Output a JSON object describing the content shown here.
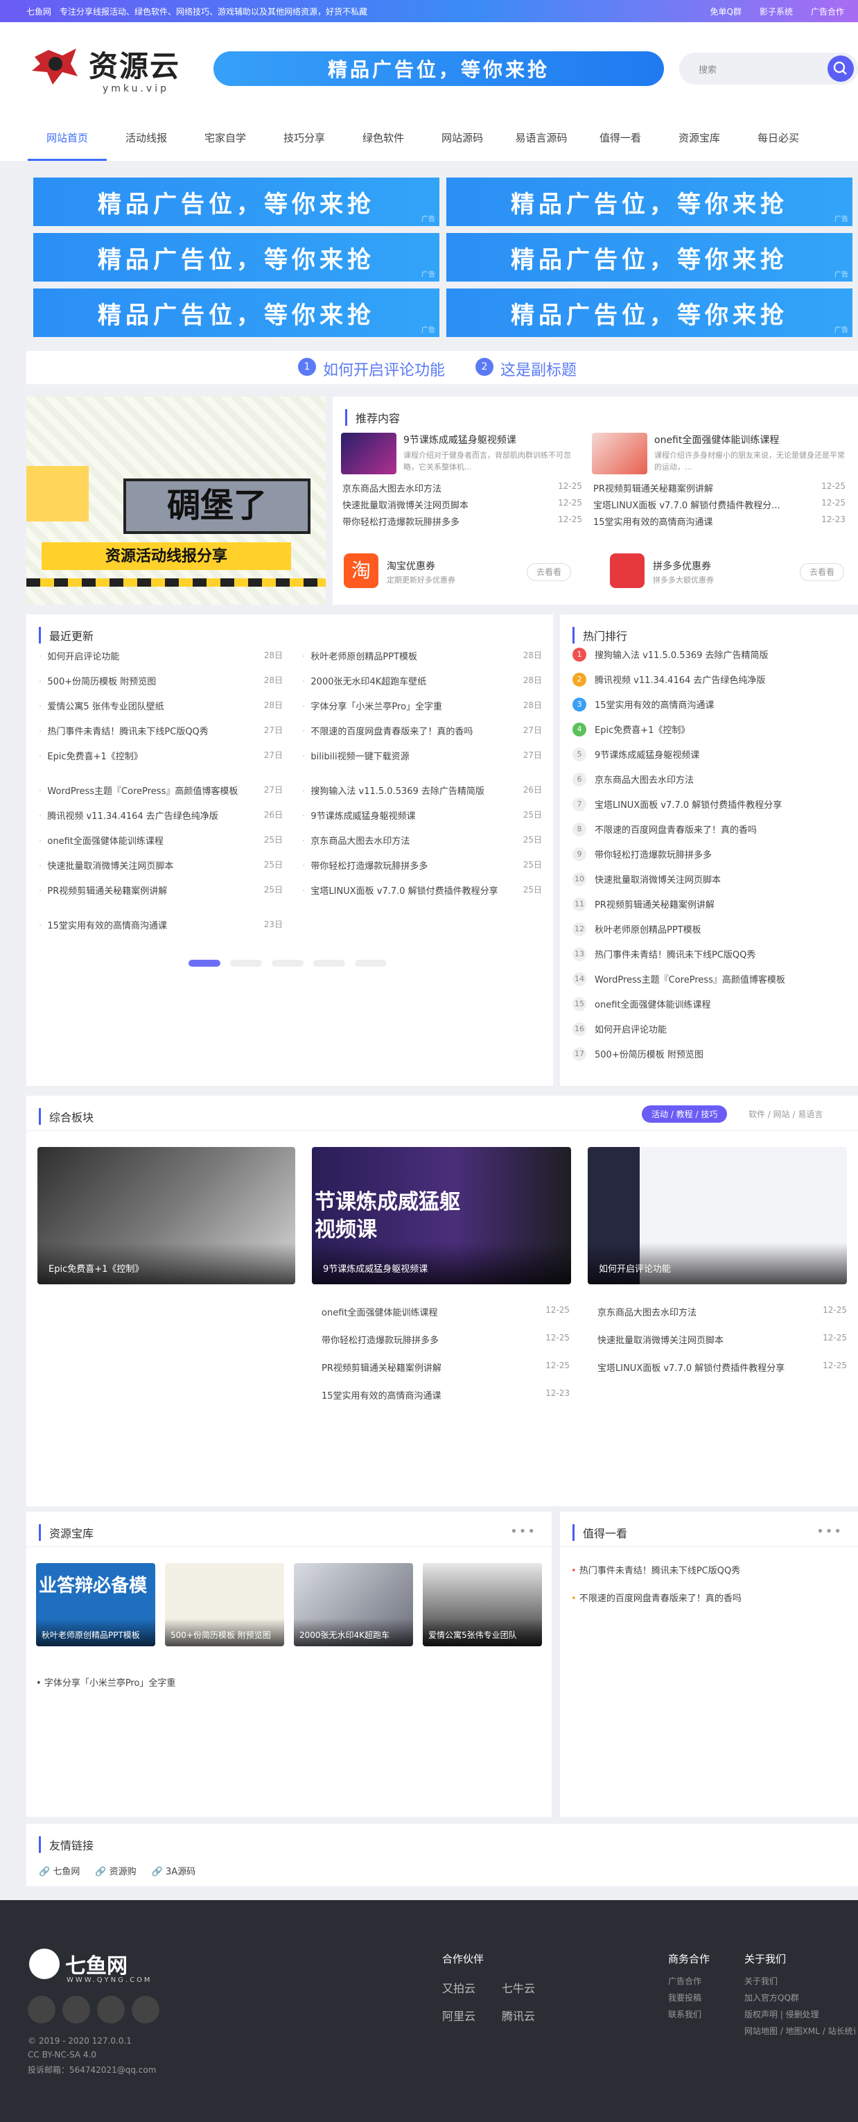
{
  "topbar": {
    "message": "七鱼网　专注分享线报活动、绿色软件、网络技巧、游戏辅助以及其他网络资源，好货不私藏",
    "links": [
      "免单Q群",
      "影子系统",
      "广告合作"
    ]
  },
  "header": {
    "logo_title": "资源云",
    "logo_sub": "ymku.vip",
    "banner": "精品广告位，等你来抢",
    "search_placeholder": "搜索"
  },
  "nav": [
    "网站首页",
    "活动线报",
    "宅家自学",
    "技巧分享",
    "绿色软件",
    "网站源码",
    "易语言源码",
    "值得一看",
    "资源宝库",
    "每日必买"
  ],
  "ads": {
    "label": "精品广告位，等你来抢",
    "tag": "广告"
  },
  "subtitle": {
    "n1": "1",
    "t1": "如何开启评论功能",
    "n2": "2",
    "t2": "这是副标题"
  },
  "hero": {
    "line1": "碉堡了",
    "line2": "资源活动线报分享"
  },
  "recommend": {
    "title": "推荐内容",
    "feature": [
      {
        "title": "9节课炼成威猛身躯视频课",
        "desc": "课程介绍对于健身者而言，背部肌肉群训练不可忽略，它关系整体机..."
      },
      {
        "title": "onefit全面强健体能训练课程",
        "desc": "课程介绍许多身材瘦小的朋友来说，无论是健身还是平常的运动，..."
      }
    ],
    "left_rows": [
      {
        "t": "京东商品大图去水印方法",
        "d": "12-25"
      },
      {
        "t": "快速批量取消微博关注网页脚本",
        "d": "12-25"
      },
      {
        "t": "带你轻松打造爆款玩腓拼多多",
        "d": "12-25"
      }
    ],
    "right_rows": [
      {
        "t": "PR视频剪辑通关秘籍案例讲解",
        "d": "12-25"
      },
      {
        "t": "宝塔LINUX面板 v7.7.0 解锁付费插件教程分...",
        "d": "12-25"
      },
      {
        "t": "15堂实用有效的高情商沟通课",
        "d": "12-23"
      }
    ],
    "coupons": [
      {
        "title": "淘宝优惠券",
        "desc": "定期更新好多优惠券",
        "btn": "去看看"
      },
      {
        "title": "拼多多优惠券",
        "desc": "拼多多大额优惠券",
        "btn": "去看看"
      }
    ]
  },
  "latest": {
    "title": "最近更新",
    "col1": [
      {
        "t": "如何开启评论功能",
        "d": "28日"
      },
      {
        "t": "500+份简历模板 附预览图",
        "d": "28日"
      },
      {
        "t": "爱情公寓5 张伟专业团队壁纸",
        "d": "28日"
      },
      {
        "t": "热门事件未青结！腾讯未下线PC版QQ秀",
        "d": "27日"
      },
      {
        "t": "Epic免费喜+1《控制》",
        "d": "27日"
      },
      {
        "t": "WordPress主题『CorePress』高颜值博客模板",
        "d": "27日"
      },
      {
        "t": "腾讯视频 v11.34.4164 去广告绿色纯净版",
        "d": "26日"
      },
      {
        "t": "onefit全面强健体能训练课程",
        "d": "25日"
      },
      {
        "t": "快速批量取消微博关注网页脚本",
        "d": "25日"
      },
      {
        "t": "PR视频剪辑通关秘籍案例讲解",
        "d": "25日"
      },
      {
        "t": "15堂实用有效的高情商沟通课",
        "d": "23日"
      }
    ],
    "col2": [
      {
        "t": "秋叶老师原创精品PPT模板",
        "d": "28日"
      },
      {
        "t": "2000张无水印4K超跑车壁纸",
        "d": "28日"
      },
      {
        "t": "字体分享「小米兰亭Pro」全字重",
        "d": "28日"
      },
      {
        "t": "不限速的百度网盘青春版来了！真的香吗",
        "d": "27日"
      },
      {
        "t": "bilibili视频一键下载资源",
        "d": "27日"
      },
      {
        "t": "搜狗输入法 v11.5.0.5369 去除广告精简版",
        "d": "26日"
      },
      {
        "t": "9节课炼成威猛身躯视频课",
        "d": "25日"
      },
      {
        "t": "京东商品大图去水印方法",
        "d": "25日"
      },
      {
        "t": "带你轻松打造爆款玩腓拼多多",
        "d": "25日"
      },
      {
        "t": "宝塔LINUX面板 v7.7.0 解锁付费插件教程分享",
        "d": "25日"
      }
    ]
  },
  "hot": {
    "title": "热门排行",
    "items": [
      "搜狗输入法 v11.5.0.5369 去除广告精简版",
      "腾讯视频 v11.34.4164 去广告绿色纯净版",
      "15堂实用有效的高情商沟通课",
      "Epic免费喜+1《控制》",
      "9节课炼成威猛身躯视频课",
      "京东商品大图去水印方法",
      "宝塔LINUX面板 v7.7.0 解锁付费插件教程分享",
      "不限速的百度网盘青春版来了！真的香吗",
      "带你轻松打造爆款玩腓拼多多",
      "快速批量取消微博关注网页脚本",
      "PR视频剪辑通关秘籍案例讲解",
      "秋叶老师原创精品PPT模板",
      "热门事件未青结！腾讯未下线PC版QQ秀",
      "WordPress主题『CorePress』高颜值博客模板",
      "onefit全面强健体能训练课程",
      "如何开启评论功能",
      "500+份简历模板 附预览图"
    ],
    "nums": [
      "1",
      "2",
      "3",
      "4",
      "5",
      "6",
      "7",
      "8",
      "9",
      "10",
      "11",
      "12",
      "13",
      "14",
      "15",
      "16",
      "17"
    ]
  },
  "combo": {
    "title": "综合板块",
    "tab_active": "活动 / 教程 / 技巧",
    "tab_other": "软件 / 网站 / 易语言",
    "cards": [
      "Epic免费喜+1《控制》",
      "9节课炼成威猛身躯视频课",
      "如何开启评论功能"
    ],
    "card2_text": "节课炼成威猛躯视频课",
    "left_rows": [
      {
        "t": "onefit全面强健体能训练课程",
        "d": "12-25"
      },
      {
        "t": "带你轻松打造爆款玩腓拼多多",
        "d": "12-25"
      },
      {
        "t": "PR视频剪辑通关秘籍案例讲解",
        "d": "12-25"
      },
      {
        "t": "15堂实用有效的高情商沟通课",
        "d": "12-23"
      }
    ],
    "right_rows": [
      {
        "t": "京东商品大图去水印方法",
        "d": "12-25"
      },
      {
        "t": "快速批量取消微博关注网页脚本",
        "d": "12-25"
      },
      {
        "t": "宝塔LINUX面板 v7.7.0 解锁付费插件教程分享",
        "d": "12-25"
      }
    ]
  },
  "treasure": {
    "title": "资源宝库",
    "thumbs": [
      "秋叶老师原创精品PPT模板",
      "500+份简历模板 附预览图",
      "2000张无水印4K超跑车",
      "爱情公寓5张伟专业团队"
    ],
    "thumb1_text": "业答辩必备模",
    "row": "字体分享「小米兰亭Pro」全字重"
  },
  "worth": {
    "title": "值得一看",
    "rows": [
      "热门事件未青结！腾讯未下线PC版QQ秀",
      "不限速的百度网盘青春版来了！真的香吗"
    ]
  },
  "links": {
    "title": "友情链接",
    "items": [
      "七鱼网",
      "资源购",
      "3A源码"
    ]
  },
  "footer": {
    "logo": "七鱼网",
    "logo_sub": "WWW.QYNG.COM",
    "copy1": "© 2019 - 2020 127.0.0.1",
    "copy2": "CC BY-NC-SA 4.0",
    "copy3": "投诉邮箱：564742021@qq.com",
    "partners_title": "合作伙伴",
    "partners": [
      "又拍云",
      "七牛云",
      "阿里云",
      "腾讯云"
    ],
    "biz_title": "商务合作",
    "biz": [
      "广告合作",
      "我要投稿",
      "联系我们"
    ],
    "about_title": "关于我们",
    "about": [
      "关于我们",
      "加入官方QQ群",
      "版权声明 | 侵删处理",
      "网站地图 / 地图XML / 站长统计"
    ]
  }
}
